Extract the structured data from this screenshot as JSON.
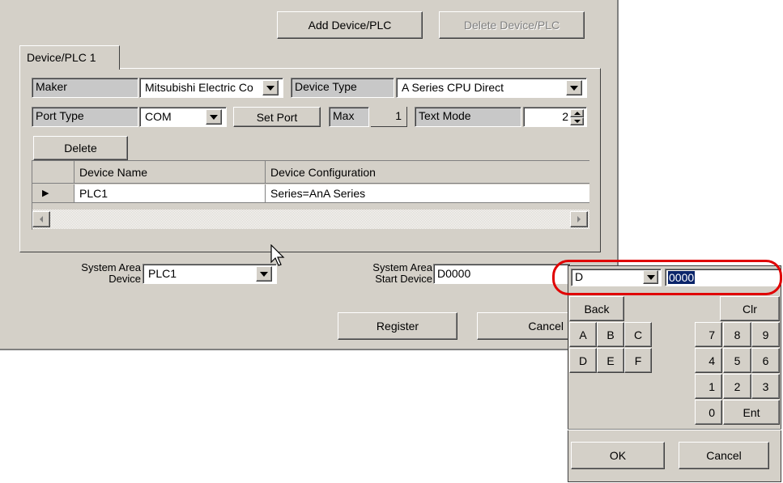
{
  "top_buttons": {
    "add": "Add Device/PLC",
    "delete": "Delete Device/PLC"
  },
  "tab": {
    "label": "Device/PLC 1"
  },
  "fields": {
    "maker_label": "Maker",
    "maker_value": "Mitsubishi Electric Co",
    "device_type_label": "Device Type",
    "device_type_value": "A Series CPU Direct",
    "port_type_label": "Port Type",
    "port_type_value": "COM",
    "set_port": "Set Port",
    "max_label": "Max",
    "max_value": "1",
    "text_mode_label": "Text Mode",
    "text_mode_value": "2"
  },
  "delete_button": "Delete",
  "table": {
    "columns": [
      "Device Name",
      "Device Configuration"
    ],
    "rows": [
      {
        "marker": "▶",
        "name": "PLC1",
        "config": "Series=AnA Series"
      }
    ]
  },
  "system_area": {
    "device_label_1": "System Area",
    "device_label_2": "Device",
    "device_value": "PLC1",
    "start_label_1": "System Area",
    "start_label_2": "Start Device",
    "start_value": "D0000"
  },
  "dialog_buttons": {
    "register": "Register",
    "cancel": "Cancel"
  },
  "keypad": {
    "device_type": "D",
    "address": "0000",
    "back": "Back",
    "clr": "Clr",
    "letters": [
      "A",
      "B",
      "C",
      "D",
      "E",
      "F"
    ],
    "digits": [
      "7",
      "8",
      "9",
      "4",
      "5",
      "6",
      "1",
      "2",
      "3",
      "0"
    ],
    "ent": "Ent",
    "ok": "OK",
    "cancel": "Cancel"
  },
  "colors": {
    "dialog_bg": "#d4d0c8",
    "highlight": "#0a246a",
    "callout": "#e00000"
  }
}
